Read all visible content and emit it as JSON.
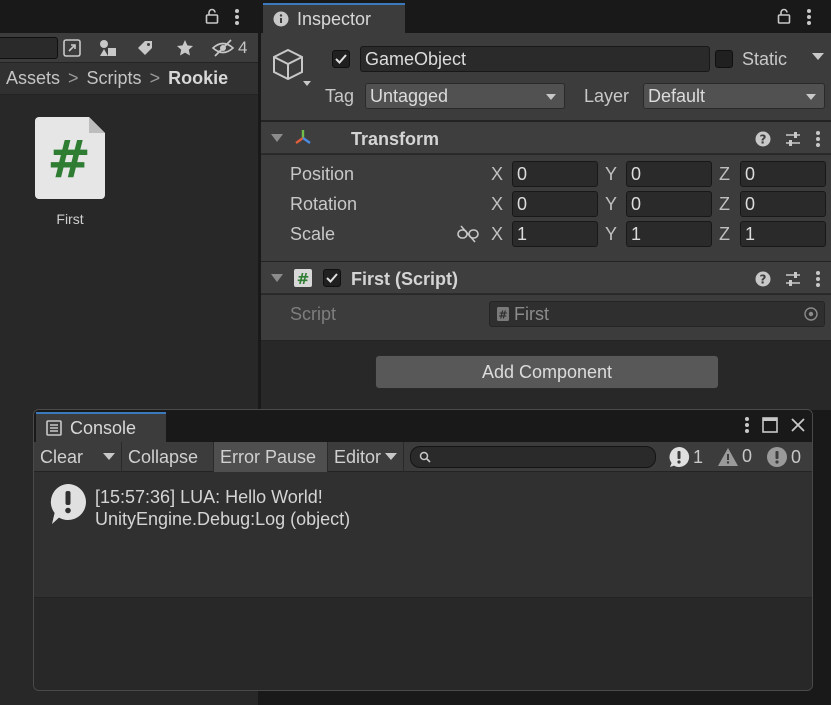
{
  "project": {
    "hidden_count": "4",
    "breadcrumb": [
      "Assets",
      "Scripts",
      "Rookie"
    ],
    "asset": {
      "label": "First",
      "icon": "csharp-script-icon",
      "glyph": "#",
      "glyph_color": "#2e7d32"
    }
  },
  "inspector": {
    "tab_label": "Inspector",
    "object_active": true,
    "object_name": "GameObject",
    "static_label": "Static",
    "static_checked": false,
    "tag_label": "Tag",
    "tag_value": "Untagged",
    "layer_label": "Layer",
    "layer_value": "Default",
    "transform": {
      "title": "Transform",
      "position": {
        "label": "Position",
        "x": "0",
        "y": "0",
        "z": "0"
      },
      "rotation": {
        "label": "Rotation",
        "x": "0",
        "y": "0",
        "z": "0"
      },
      "scale": {
        "label": "Scale",
        "x": "1",
        "y": "1",
        "z": "1"
      },
      "axis_x": "X",
      "axis_y": "Y",
      "axis_z": "Z"
    },
    "script_component": {
      "title": "First (Script)",
      "enabled": true,
      "script_label": "Script",
      "script_value": "First"
    },
    "add_component_label": "Add Component"
  },
  "console": {
    "tab_label": "Console",
    "toolbar": {
      "clear": "Clear",
      "collapse": "Collapse",
      "error_pause": "Error Pause",
      "editor": "Editor",
      "info_count": "1",
      "warn_count": "0",
      "error_count": "0"
    },
    "log": {
      "line1": "[15:57:36] LUA: Hello World!",
      "line2": "UnityEngine.Debug:Log (object)"
    }
  },
  "colors": {
    "accent": "#3a79bb",
    "panel": "#282828",
    "header": "#3c3c3c"
  }
}
